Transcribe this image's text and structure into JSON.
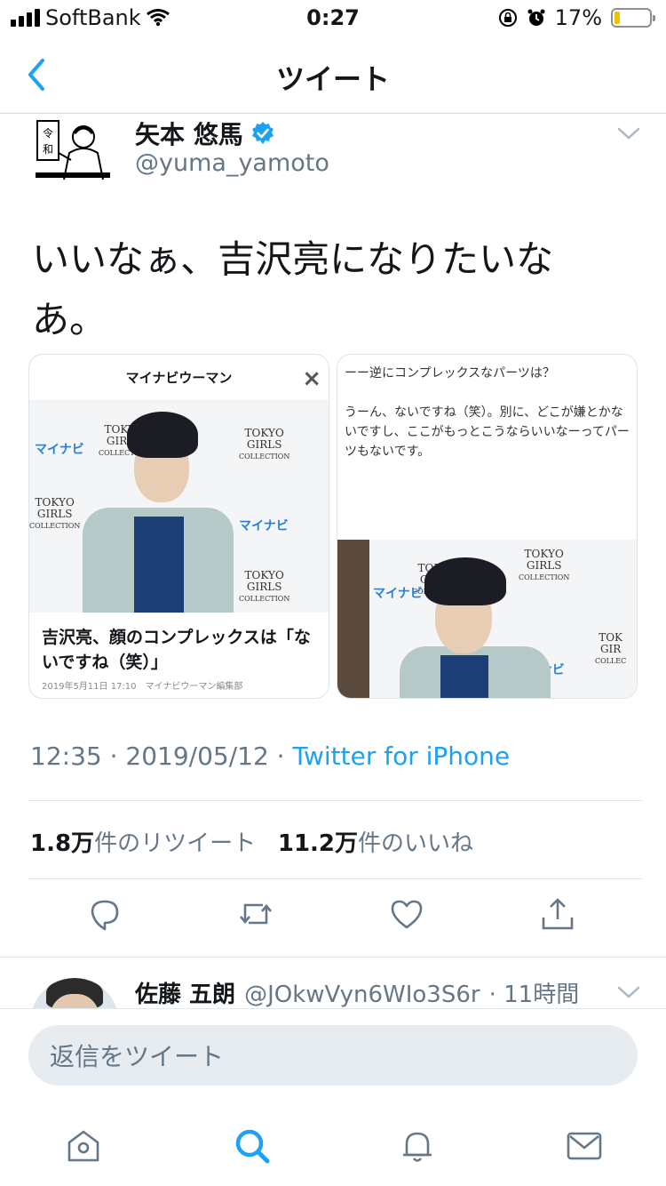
{
  "status": {
    "carrier": "SoftBank",
    "time": "0:27",
    "battery_text": "17%",
    "battery_level": 0.17
  },
  "nav": {
    "title": "ツイート"
  },
  "tweet": {
    "author_name": "矢本 悠馬",
    "handle": "@yuma_yamoto",
    "avatar_text": [
      "令",
      "和"
    ],
    "text_line1": "いいなぁ、吉沢亮になりたいな",
    "text_line2": "あ。",
    "timestamp": "12:35 · 2019/05/12 · ",
    "source": "Twitter for iPhone",
    "retweets_count": "1.8万",
    "retweets_label": "件のリツイート",
    "likes_count": "11.2万",
    "likes_label": "件のいいね"
  },
  "cards": {
    "left": {
      "header": "マイナビウーマン",
      "close": "×",
      "title": "吉沢亮、顔のコンプレックスは「ないですね（笑）」",
      "meta": "2019年5月11日 17:10　マイナビウーマン編集部",
      "backdrop": [
        "TOKYO",
        "GIRLS",
        "COLLECTION"
      ],
      "logo": "マイナビ"
    },
    "right": {
      "question": "ーー逆にコンプレックスなパーツは？",
      "answer": "うーん、ないですね（笑）。別に、どこが嫌とかないですし、ここがもっとこうならいいなーってパーツもないです。",
      "backdrop": [
        "TOKYO",
        "GIRLS",
        "COLLECTION"
      ],
      "backdrop_partial": [
        "TOK",
        "GIR",
        "COLLEC"
      ],
      "logo": "マイナビ"
    }
  },
  "reply": {
    "name": "佐藤 五朗",
    "handle": "@JOkwVyn6WIo3S6r",
    "time": "· 11時間"
  },
  "composer": {
    "placeholder": "返信をツイート"
  },
  "colors": {
    "accent": "#1da1f2",
    "muted": "#657786"
  }
}
